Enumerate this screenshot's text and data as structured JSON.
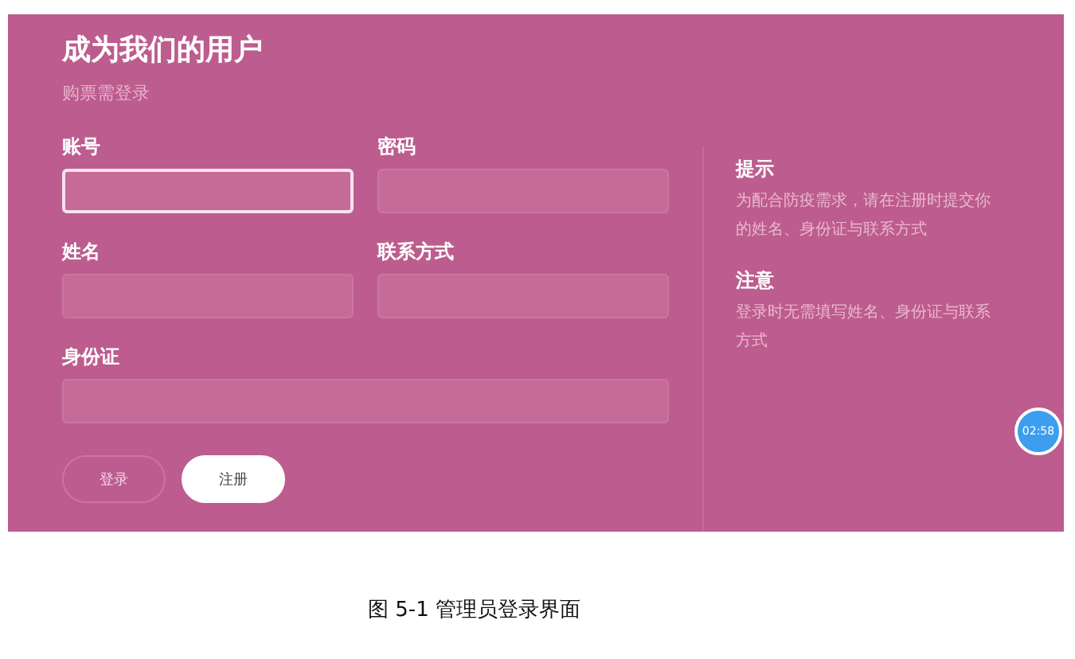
{
  "title": "成为我们的用户",
  "subtitle": "购票需登录",
  "fields": [
    {
      "label": "账号",
      "focused": true,
      "wide": false
    },
    {
      "label": "密码",
      "focused": false,
      "wide": false
    },
    {
      "label": "姓名",
      "focused": false,
      "wide": false
    },
    {
      "label": "联系方式",
      "focused": false,
      "wide": false
    },
    {
      "label": "身份证",
      "focused": false,
      "wide": true
    }
  ],
  "buttons": [
    {
      "label": "登录",
      "kind": "outline"
    },
    {
      "label": "注册",
      "kind": "filled"
    }
  ],
  "notes": [
    {
      "heading": "提示",
      "text": "为配合防疫需求，请在注册时提交你的姓名、身份证与联系方式"
    },
    {
      "heading": "注意",
      "text": "登录时无需填写姓名、身份证与联系方式"
    }
  ],
  "timer": "02:58",
  "caption": "图 5-1 管理员登录界面"
}
